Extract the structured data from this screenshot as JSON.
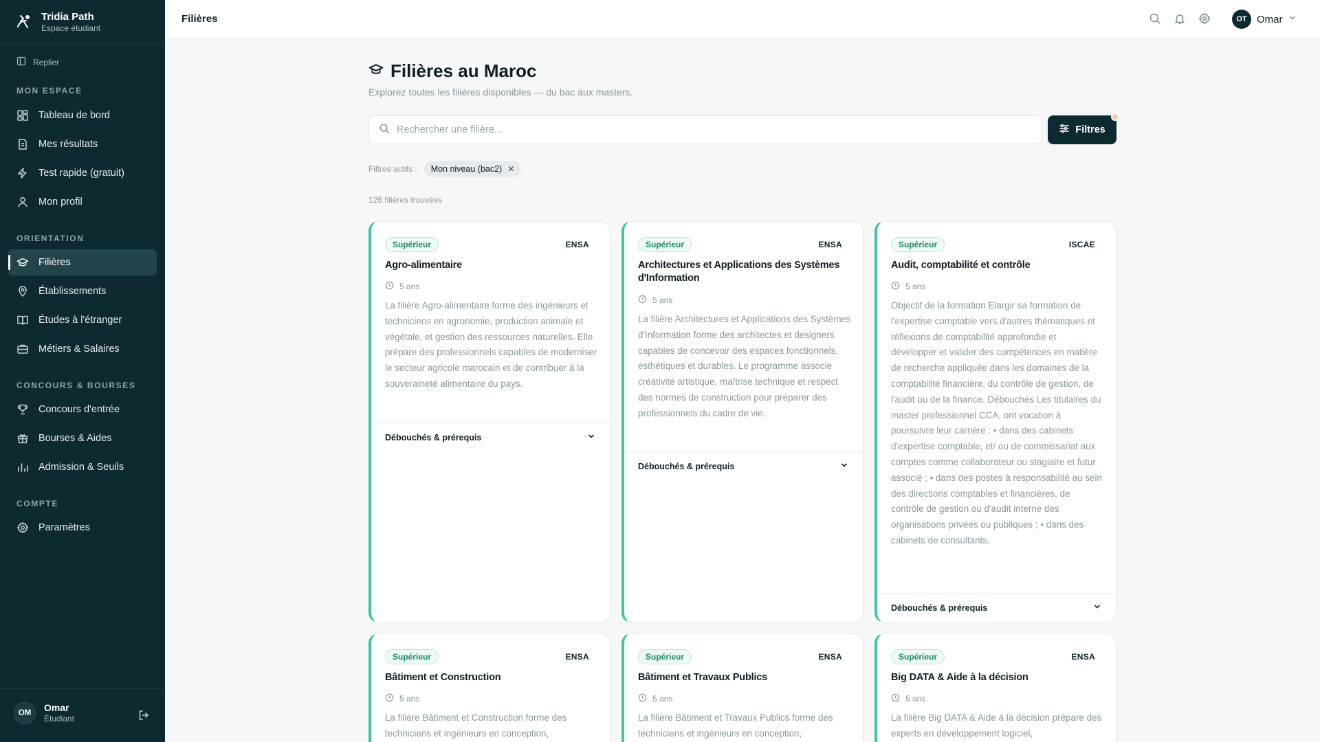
{
  "sidebar": {
    "brand": {
      "name": "Tridia Path",
      "subtitle": "Espace étudiant"
    },
    "collapse_label": "Replier",
    "sections": [
      {
        "title": "MON ESPACE",
        "items": [
          {
            "label": "Tableau de bord",
            "icon": "dashboard-icon"
          },
          {
            "label": "Mes résultats",
            "icon": "document-icon"
          },
          {
            "label": "Test rapide (gratuit)",
            "icon": "lightning-icon"
          },
          {
            "label": "Mon profil",
            "icon": "user-icon"
          }
        ]
      },
      {
        "title": "ORIENTATION",
        "items": [
          {
            "label": "Filières",
            "icon": "graduation-cap-icon",
            "active": true
          },
          {
            "label": "Établissements",
            "icon": "map-pin-icon"
          },
          {
            "label": "Études à l'étranger",
            "icon": "book-open-icon"
          },
          {
            "label": "Métiers & Salaires",
            "icon": "briefcase-icon"
          }
        ]
      },
      {
        "title": "CONCOURS & BOURSES",
        "items": [
          {
            "label": "Concours d'entrée",
            "icon": "trophy-icon"
          },
          {
            "label": "Bourses & Aides",
            "icon": "gift-icon"
          },
          {
            "label": "Admission & Seuils",
            "icon": "bar-chart-icon"
          }
        ]
      },
      {
        "title": "COMPTE",
        "items": [
          {
            "label": "Paramètres",
            "icon": "gear-icon"
          }
        ]
      }
    ],
    "user": {
      "initials": "OM",
      "name": "Omar",
      "role": "Étudiant"
    }
  },
  "topbar": {
    "breadcrumb": "Filières",
    "user": {
      "initials": "OT",
      "name": "Omar"
    }
  },
  "main": {
    "title": "Filières au Maroc",
    "subtitle": "Explorez toutes les filières disponibles — du bac aux masters.",
    "search": {
      "placeholder": "Rechercher une filière...",
      "value": ""
    },
    "filters_button": "Filtres",
    "active_filters_label": "Filtres actifs :",
    "active_filters": [
      "Mon niveau (bac2)"
    ],
    "result_count": "126 filières trouvées",
    "footer_label": "Débouchés & prérequis",
    "cards": [
      {
        "badge": "Supérieur",
        "institution": "ENSA",
        "title": "Agro-alimentaire",
        "duration": "5 ans",
        "description": "La filière Agro-alimentaire forme des ingénieurs et techniciens en agronomie, production animale et végétale, et gestion des ressources naturelles. Elle prépare des professionnels capables de moderniser le secteur agricole marocain et de contribuer à la souveraineté alimentaire du pays."
      },
      {
        "badge": "Supérieur",
        "institution": "ENSA",
        "title": "Architectures et Applications des Systèmes d'Information",
        "duration": "5 ans",
        "description": "La filière Architectures et Applications des Systèmes d'Information forme des architectes et designers capables de concevoir des espaces fonctionnels, esthétiques et durables. Le programme associe créativité artistique, maîtrise technique et respect des normes de construction pour préparer des professionnels du cadre de vie."
      },
      {
        "badge": "Supérieur",
        "institution": "ISCAE",
        "title": "Audit, comptabilité et contrôle",
        "duration": "5 ans",
        "description": "Objectif de la formation Elargir sa formation de l'expertise comptable vers d'autres thématiques et réflexions de comptabilité approfondie et développer et valider des compétences en matière de recherche appliquée dans les domaines de la comptabilité financière, du contrôle de gestion, de l'audit ou de la finance. Débouchés Les titulaires du master professionnel CCA, ont vocation à poursuivre leur carrière : • dans des cabinets d'expertise comptable, et/ ou de commissariat aux comptes comme collaborateur ou stagiaire et futur associé ; • dans des postes à responsabilité au sein des directions comptables et financières, de contrôle de gestion ou d'audit interne des organisations privées ou publiques ; • dans des cabinets de consultants."
      },
      {
        "badge": "Supérieur",
        "institution": "ENSA",
        "title": "Bâtiment et Construction",
        "duration": "5 ans",
        "description": "La filière Bâtiment et Construction forme des techniciens et ingénieurs en conception,"
      },
      {
        "badge": "Supérieur",
        "institution": "ENSA",
        "title": "Bâtiment et Travaux Publics",
        "duration": "5 ans",
        "description": "La filière Bâtiment et Travaux Publics forme des techniciens et ingénieurs en conception,"
      },
      {
        "badge": "Supérieur",
        "institution": "ENSA",
        "title": "Big DATA & Aide à la décision",
        "duration": "5 ans",
        "description": "La filière Big DATA & Aide à la décision prépare des experts en développement logiciel,"
      }
    ]
  }
}
